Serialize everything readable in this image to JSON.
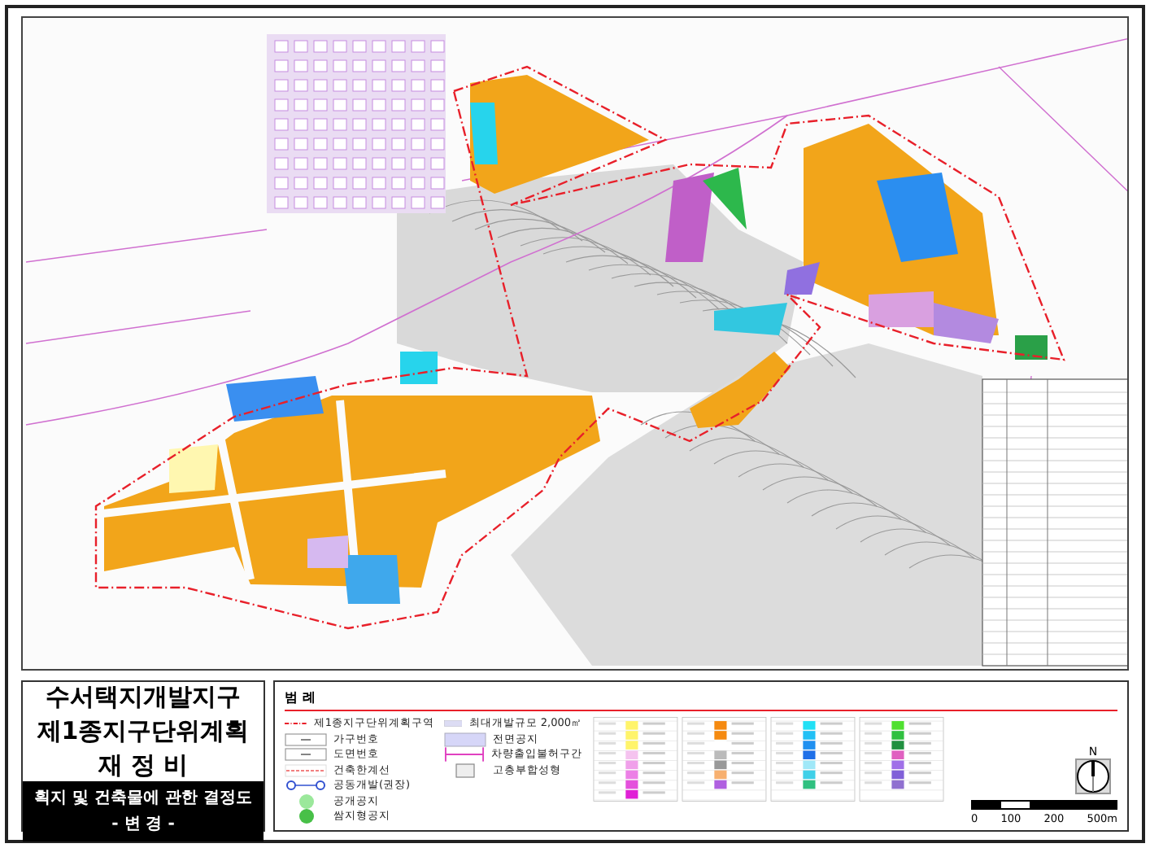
{
  "title_block": {
    "title_lines": [
      "수서택지개발지구",
      "제1종지구단위계획",
      "재 정 비"
    ],
    "subtitle": "획지 및 건축물에 관한 결정도",
    "revision": "- 변 경 -"
  },
  "legend": {
    "title": "범 례",
    "items": [
      {
        "kind": "boundary",
        "label": "제1종지구단위계획구역"
      },
      {
        "kind": "block",
        "label": "가구번호"
      },
      {
        "kind": "plot",
        "label": "도면번호"
      },
      {
        "kind": "building-line",
        "label": "건축한계선"
      },
      {
        "kind": "joint",
        "label": "공동개발(권장)"
      },
      {
        "kind": "open-space",
        "label": "공개공지"
      },
      {
        "kind": "pocket",
        "label": "쌈지형공지"
      },
      {
        "kind": "max-size",
        "label": "최대개발규모 2,000㎡"
      },
      {
        "kind": "front",
        "label": "전면공지"
      },
      {
        "kind": "no-vehicle",
        "label": "차량출입불허구간"
      },
      {
        "kind": "high-rise",
        "label": "고층부합성형"
      }
    ]
  },
  "scale_bar": {
    "labels": [
      "0",
      "100",
      "200",
      "500m"
    ]
  },
  "north_arrow": {
    "label": "N"
  }
}
